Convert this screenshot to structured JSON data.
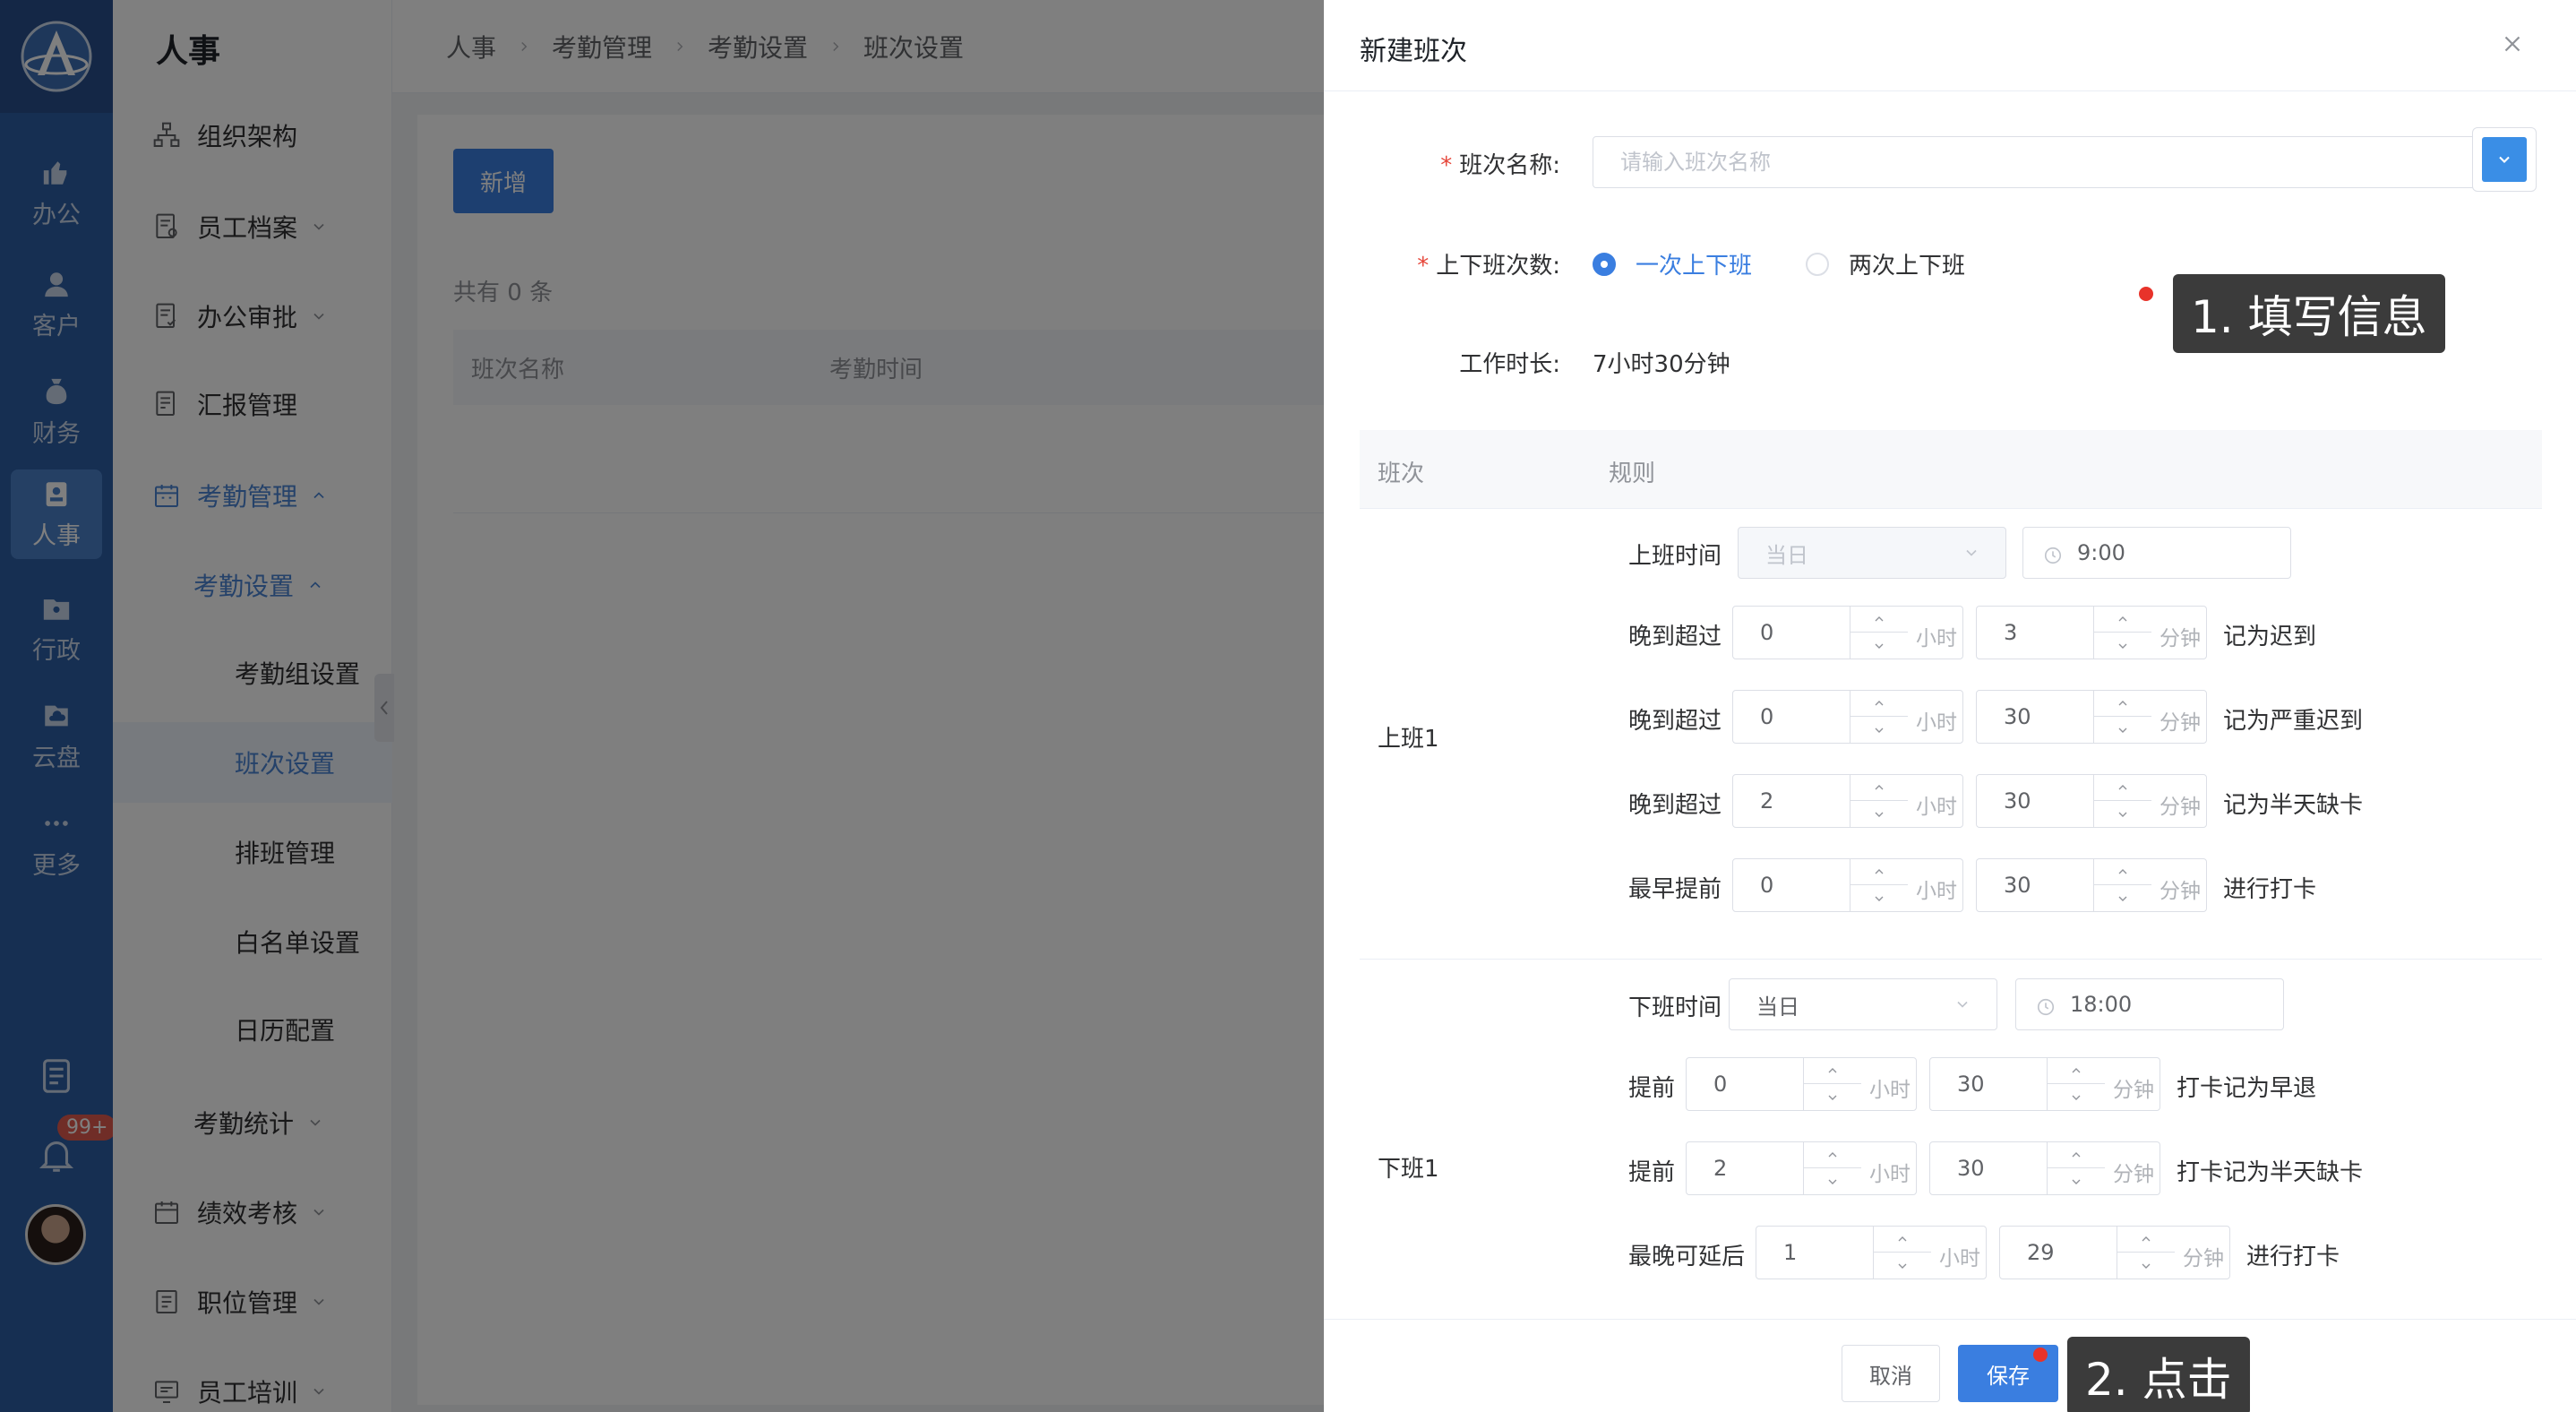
{
  "rail": {
    "items": [
      {
        "label": "办公"
      },
      {
        "label": "客户"
      },
      {
        "label": "财务"
      },
      {
        "label": "人事"
      },
      {
        "label": "行政"
      },
      {
        "label": "云盘"
      },
      {
        "label": "更多"
      }
    ],
    "notification_badge": "99+"
  },
  "submenu": {
    "title": "人事",
    "items": [
      {
        "label": "组织架构"
      },
      {
        "label": "员工档案"
      },
      {
        "label": "办公审批"
      },
      {
        "label": "汇报管理"
      },
      {
        "label": "考勤管理"
      },
      {
        "label": "考勤设置"
      },
      {
        "label": "考勤组设置"
      },
      {
        "label": "班次设置"
      },
      {
        "label": "排班管理"
      },
      {
        "label": "白名单设置"
      },
      {
        "label": "日历配置"
      },
      {
        "label": "考勤统计"
      },
      {
        "label": "绩效考核"
      },
      {
        "label": "职位管理"
      },
      {
        "label": "员工培训"
      }
    ]
  },
  "breadcrumb": [
    "人事",
    "考勤管理",
    "考勤设置",
    "班次设置"
  ],
  "list": {
    "add_label": "新增",
    "total_text": "共有 0 条",
    "columns": [
      "班次名称",
      "考勤时间"
    ]
  },
  "drawer": {
    "title": "新建班次",
    "name_label": "班次名称:",
    "name_placeholder": "请输入班次名称",
    "count_label": "上下班次数:",
    "radio_once": "一次上下班",
    "radio_twice": "两次上下班",
    "duration_label": "工作时长:",
    "duration_value": "7小时30分钟",
    "rules_columns": [
      "班次",
      "规则"
    ],
    "unit_hour": "小时",
    "unit_min": "分钟",
    "on_section": {
      "label": "上班1",
      "time_label": "上班时间",
      "day": "当日",
      "time": "9:00",
      "rows": [
        {
          "label": "晚到超过",
          "hours": "0",
          "minutes": "3",
          "suffix": "记为迟到"
        },
        {
          "label": "晚到超过",
          "hours": "0",
          "minutes": "30",
          "suffix": "记为严重迟到"
        },
        {
          "label": "晚到超过",
          "hours": "2",
          "minutes": "30",
          "suffix": "记为半天缺卡"
        },
        {
          "label": "最早提前",
          "hours": "0",
          "minutes": "30",
          "suffix": "进行打卡"
        }
      ]
    },
    "off_section": {
      "label": "下班1",
      "time_label": "下班时间",
      "day": "当日",
      "time": "18:00",
      "rows": [
        {
          "label": "提前",
          "hours": "0",
          "minutes": "30",
          "suffix": "打卡记为早退"
        },
        {
          "label": "提前",
          "hours": "2",
          "minutes": "30",
          "suffix": "打卡记为半天缺卡"
        },
        {
          "label": "最晚可延后",
          "hours": "1",
          "minutes": "29",
          "suffix": "进行打卡"
        }
      ]
    },
    "cancel_label": "取消",
    "save_label": "保存",
    "accent_color": "#3a7ee0",
    "shift_color": "#3a8ee6"
  },
  "callouts": {
    "step1": "1. 填写信息",
    "step2": "2. 点击"
  }
}
